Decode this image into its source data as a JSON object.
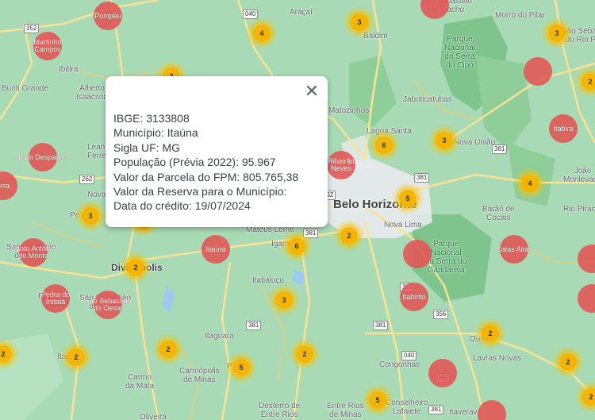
{
  "map": {
    "colors": {
      "land": "#a8dab5",
      "park": "#7fc48c",
      "urban": "#e8eaed",
      "road": "#fde293",
      "municipality": "#e45454",
      "cluster": "#f5b400"
    },
    "labels": [
      {
        "id": "araca",
        "text": "Araçaí"
      },
      {
        "id": "baldim",
        "text": "Baldim"
      },
      {
        "id": "jaboticatubas",
        "text": "Jaboticatubas"
      },
      {
        "id": "lagoa-santa",
        "text": "Lagoa Santa"
      },
      {
        "id": "nova-uniao",
        "text": "Nova União"
      },
      {
        "id": "morro-pilar",
        "text": "Morro do Pilar"
      },
      {
        "id": "sao-sebastiao-rio-preto",
        "text": "São Sebastião\ndo Rio Preto"
      },
      {
        "id": "sao-sebastiao-riacho",
        "text": "São Sebastião\ndo Riacho"
      },
      {
        "id": "ibitira",
        "text": "Ibitira"
      },
      {
        "id": "buriti-grande",
        "text": "Buriti Grande"
      },
      {
        "id": "alberto-isaacson",
        "text": "Alberto\nIsaacson"
      },
      {
        "id": "leandro-ferreira",
        "text": "Lean\nFerre"
      },
      {
        "id": "nova-serrana",
        "text": "Nova"
      },
      {
        "id": "matozinhos",
        "text": "Matozinhos"
      },
      {
        "id": "belo-horizonte",
        "text": "Belo Horizonte"
      },
      {
        "id": "nova-lima",
        "text": "Nova Lima"
      },
      {
        "id": "joao-monlevade",
        "text": "João\nMonlevade"
      },
      {
        "id": "barao-cocais",
        "text": "Barão de\nCocais"
      },
      {
        "id": "rio-piracicaba",
        "text": "Rio Piracic"
      },
      {
        "id": "mateus-leme",
        "text": "Mateus Leme"
      },
      {
        "id": "divinopolis",
        "text": "Divinópolis"
      },
      {
        "id": "igarape",
        "text": "Igara"
      },
      {
        "id": "itatiaiucu",
        "text": "Itatiaiuçu"
      },
      {
        "id": "itaguara",
        "text": "Itaguara"
      },
      {
        "id": "carmo-mata",
        "text": "Carmo\nda Mata"
      },
      {
        "id": "carmopolis",
        "text": "Carmópolis\nde Minas"
      },
      {
        "id": "piracema",
        "text": "Pira"
      },
      {
        "id": "desterro",
        "text": "Desterro de\nEntre Rios"
      },
      {
        "id": "entre-rios",
        "text": "Entre Rios\nde Minas"
      },
      {
        "id": "congonhas",
        "text": "Congonhas"
      },
      {
        "id": "conselheiro-lafaiete",
        "text": "Conselheiro\nLafaiete"
      },
      {
        "id": "lavras-novas",
        "text": "Lavras Novas"
      },
      {
        "id": "ouro-preto",
        "text": "Ouro"
      },
      {
        "id": "itaverava",
        "text": "Itaverava"
      },
      {
        "id": "oliveira",
        "text": "Oliveira"
      },
      {
        "id": "itapecerica",
        "text": "Itap"
      },
      {
        "id": "pedra-indaia",
        "text": "Pedra do\nIndaiá"
      },
      {
        "id": "sao-sebastiao-oeste",
        "text": "São Sebastião\ndo Oeste"
      },
      {
        "id": "santo-antonio-monte",
        "text": "Santo Antônio\ndo Monte"
      },
      {
        "id": "pequi",
        "text": "Pe"
      }
    ],
    "parks": [
      {
        "id": "serra-cipo",
        "text": "Parque\nNacional\nda Serra\ndo Cipó"
      },
      {
        "id": "gandarela",
        "text": "Parque\nNacional\nda Serra do\nGandarela"
      }
    ],
    "shields": [
      "040",
      "352",
      "262",
      "381",
      "262",
      "381",
      "381",
      "040",
      "381",
      "356",
      "381",
      "040",
      "381",
      "381"
    ],
    "municipalities": [
      {
        "id": "pompeu",
        "label": "Pompéu"
      },
      {
        "id": "martinho-campos",
        "label": "Martinho\nCampos"
      },
      {
        "id": "bom-despacho",
        "label": "Bom Despacho"
      },
      {
        "id": "serra",
        "label": "erra"
      },
      {
        "id": "santo-antonio-monte",
        "label": "Santo Antônio\ndo Monte"
      },
      {
        "id": "pedra-indaia",
        "label": "Pedra do\nIndaiá"
      },
      {
        "id": "sao-sebastiao-oeste",
        "label": "São Sebastião\ndo Oeste"
      },
      {
        "id": "itauna",
        "label": "Itaúna"
      },
      {
        "id": "ribeirao-neves",
        "label": "Ribeirão\nNeves"
      },
      {
        "id": "itabira",
        "label": "Itabira"
      },
      {
        "id": "sete-lagoas-east",
        "label": ""
      },
      {
        "id": "catas-altas",
        "label": "Catas Altas"
      },
      {
        "id": "santa-barbara",
        "label": ""
      },
      {
        "id": "itabirito",
        "label": "Itabirito"
      },
      {
        "id": "mariana",
        "label": ""
      },
      {
        "id": "north-edge",
        "label": ""
      },
      {
        "id": "bottom-right",
        "label": ""
      },
      {
        "id": "right-edge",
        "label": ""
      },
      {
        "id": "santo-sebastiao-riacho",
        "label": ""
      }
    ],
    "clusters": [
      {
        "id": "c1",
        "count": "4"
      },
      {
        "id": "c2",
        "count": "3"
      },
      {
        "id": "c3",
        "count": "3"
      },
      {
        "id": "c4",
        "count": "6"
      },
      {
        "id": "c5",
        "count": "3"
      },
      {
        "id": "c6",
        "count": "5"
      },
      {
        "id": "c7",
        "count": "4"
      },
      {
        "id": "c8",
        "count": "2"
      },
      {
        "id": "c9",
        "count": "3"
      },
      {
        "id": "c10",
        "count": "2"
      },
      {
        "id": "c11",
        "count": "6"
      },
      {
        "id": "c12",
        "count": "2"
      },
      {
        "id": "c13",
        "count": "3"
      },
      {
        "id": "c14",
        "count": "2"
      },
      {
        "id": "c15",
        "count": "2"
      },
      {
        "id": "c16",
        "count": "2"
      },
      {
        "id": "c17",
        "count": "5"
      },
      {
        "id": "c18",
        "count": "2"
      },
      {
        "id": "c19",
        "count": "5"
      },
      {
        "id": "c20",
        "count": "2"
      },
      {
        "id": "c21",
        "count": "2"
      },
      {
        "id": "c22",
        "count": "2"
      },
      {
        "id": "c23",
        "count": "2"
      },
      {
        "id": "c24",
        "count": "2"
      }
    ]
  },
  "popup": {
    "ibge": "IBGE: 3133808",
    "municipio": "Município: Itaúna",
    "uf": "Sigla UF: MG",
    "populacao": "População (Prévia 2022): 95.967",
    "parcela": "Valor da Parcela do FPM: 805.765,38",
    "reserva": "Valor da Reserva para o Município:",
    "data": "Data do crédito: 19/07/2024",
    "close_icon": "close-icon"
  }
}
